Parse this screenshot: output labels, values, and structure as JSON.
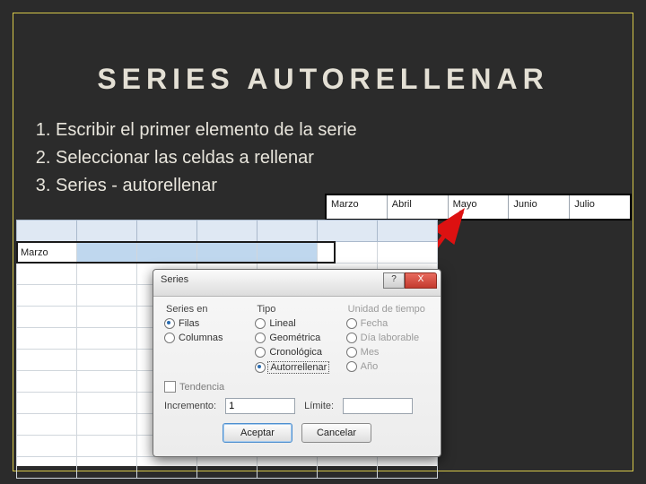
{
  "slide": {
    "title": "SERIES AUTORELLENAR",
    "steps": [
      "Escribir el primer elemento de la serie",
      "Seleccionar las celdas a rellenar",
      "Series - autorellenar"
    ]
  },
  "sheet": {
    "first_value": "Marzo"
  },
  "result_row": [
    "Marzo",
    "Abril",
    "Mayo",
    "Junio",
    "Julio"
  ],
  "dialog": {
    "title": "Series",
    "help_icon": "?",
    "close_icon": "X",
    "groups": {
      "series_en": {
        "legend": "Series en",
        "options": [
          {
            "label": "Filas",
            "selected": true
          },
          {
            "label": "Columnas",
            "selected": false
          }
        ]
      },
      "tipo": {
        "legend": "Tipo",
        "options": [
          {
            "label": "Lineal",
            "selected": false
          },
          {
            "label": "Geométrica",
            "selected": false
          },
          {
            "label": "Cronológica",
            "selected": false
          },
          {
            "label": "Autorrellenar",
            "selected": true
          }
        ]
      },
      "unidad": {
        "legend": "Unidad de tiempo",
        "options": [
          {
            "label": "Fecha"
          },
          {
            "label": "Día laborable"
          },
          {
            "label": "Mes"
          },
          {
            "label": "Año"
          }
        ]
      }
    },
    "tendencia_label": "Tendencia",
    "incremento_label": "Incremento:",
    "incremento_value": "1",
    "limite_label": "Límite:",
    "limite_value": "",
    "ok_label": "Aceptar",
    "cancel_label": "Cancelar"
  }
}
